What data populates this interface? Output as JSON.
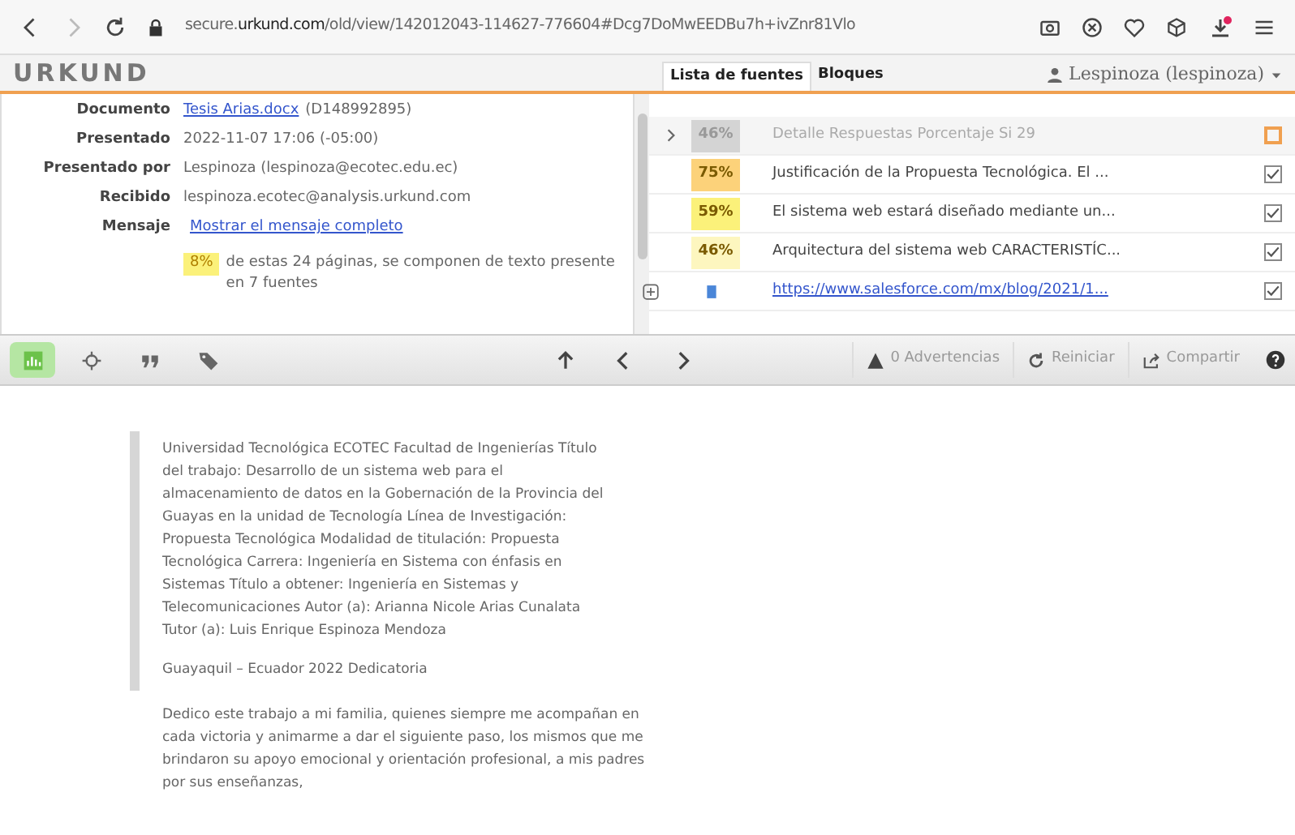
{
  "browser": {
    "url_prefix": "secure.",
    "url_domain": "urkund.com",
    "url_path": "/old/view/142012043-114627-776604#Dcg7DoMwEEDBu7h+ivZnr81Vlo"
  },
  "header": {
    "logo": "URKUND",
    "user": "Lespinoza (lespinoza)"
  },
  "info": [
    {
      "label": "Documento",
      "kind": "link",
      "link": "Tesis Arias.docx",
      "value": "(D148992895)"
    },
    {
      "label": "Presentado",
      "kind": "text",
      "value": "2022-11-07 17:06 (-05:00)"
    },
    {
      "label": "Presentado por",
      "kind": "text",
      "value": "Lespinoza (lespinoza@ecotec.edu.ec)"
    },
    {
      "label": "Recibido",
      "kind": "text",
      "value": "lespinoza.ecotec@analysis.urkund.com"
    },
    {
      "label": "Mensaje",
      "kind": "linkonly",
      "link": "Mostrar el mensaje completo"
    }
  ],
  "summary": {
    "percent": "8%",
    "text": "de estas 24 páginas, se componen de texto presente en 7 fuentes"
  },
  "source_tabs": [
    {
      "label": "Lista de fuentes",
      "selected": true
    },
    {
      "label": "Bloques",
      "selected": false
    }
  ],
  "sources": [
    {
      "kind": "block",
      "percent": "46%",
      "color": "#d4d4d4",
      "title": "Detalle Respuestas Porcentaje Si 29",
      "checked": false,
      "dimmed": true
    },
    {
      "kind": "block",
      "percent": "75%",
      "color": "#fcd27a",
      "title": "Justificación de la Propuesta Tecnológica. El ...",
      "checked": true,
      "dimmed": false
    },
    {
      "kind": "block",
      "percent": "59%",
      "color": "#fbf17a",
      "title": "El sistema web estará diseñado mediante un...",
      "checked": true,
      "dimmed": false
    },
    {
      "kind": "block",
      "percent": "46%",
      "color": "#fdf6bf",
      "title": "Arquitectura del sistema web CARACTERISTÍC...",
      "checked": true,
      "dimmed": false
    },
    {
      "kind": "source",
      "title": "https://www.salesforce.com/mx/blog/2021/1...",
      "checked": true,
      "dimmed": false
    }
  ],
  "toolbar": {
    "warnings": "0 Advertencias",
    "restart": "Reiniciar",
    "share": "Compartir"
  },
  "document": {
    "quote": [
      "Universidad Tecnológica ECOTEC Facultad de Ingenierías Título del trabajo: Desarrollo de un sistema web para el almacenamiento de datos en la Gobernación de la Provincia del Guayas en la unidad de Tecnología Línea de Investigación: Propuesta Tecnológica Modalidad de titulación: Propuesta Tecnológica Carrera: Ingeniería en Sistema con énfasis en Sistemas Título a obtener: Ingeniería en Sistemas y Telecomunicaciones Autor (a): Arianna Nicole Arias Cunalata Tutor (a): Luis Enrique Espinoza Mendoza",
      "Guayaquil – Ecuador 2022 Dedicatoria"
    ],
    "paragraphs": [
      "Dedico este trabajo a mi familia, quienes siempre me acompañan en cada victoria y animarme a dar el siguiente paso, los mismos que me brindaron su apoyo emocional y orientación profesional, a mis padres por sus enseñanzas,"
    ]
  }
}
